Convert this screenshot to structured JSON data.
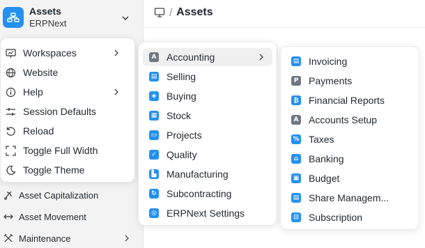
{
  "app": {
    "title": "Assets",
    "subtitle": "ERPNext"
  },
  "breadcrumb": {
    "separator": "/",
    "title": "Assets"
  },
  "sidebar": {
    "items": [
      {
        "label": "Asset Capitalization",
        "icon": "asset-capitalization-icon"
      },
      {
        "label": "Asset Movement",
        "icon": "arrows-left-right-icon"
      },
      {
        "label": "Maintenance",
        "icon": "tools-icon"
      }
    ]
  },
  "app_menu": {
    "items": [
      {
        "label": "Workspaces",
        "icon": "presentation-icon",
        "has_submenu": true
      },
      {
        "label": "Website",
        "icon": "globe-icon"
      },
      {
        "label": "Help",
        "icon": "info-icon",
        "has_submenu": true
      },
      {
        "label": "Session Defaults",
        "icon": "sliders-icon"
      },
      {
        "label": "Reload",
        "icon": "reload-icon"
      },
      {
        "label": "Toggle Full Width",
        "icon": "expand-icon"
      },
      {
        "label": "Toggle Theme",
        "icon": "moon-icon"
      }
    ]
  },
  "workspaces_menu": {
    "items": [
      {
        "label": "Accounting",
        "icon_letter": "A",
        "tone": "gray",
        "has_submenu": true,
        "active": true
      },
      {
        "label": "Selling",
        "icon_letter": "▤",
        "tone": "blue"
      },
      {
        "label": "Buying",
        "icon_letter": "◈",
        "tone": "blue"
      },
      {
        "label": "Stock",
        "icon_letter": "▦",
        "tone": "blue"
      },
      {
        "label": "Projects",
        "icon_letter": "▭",
        "tone": "blue"
      },
      {
        "label": "Quality",
        "icon_letter": "✓",
        "tone": "blue"
      },
      {
        "label": "Manufacturing",
        "icon_letter": "▙",
        "tone": "blue"
      },
      {
        "label": "Subcontracting",
        "icon_letter": "↻",
        "tone": "blue"
      },
      {
        "label": "ERPNext Settings",
        "icon_letter": "◎",
        "tone": "blue"
      }
    ]
  },
  "accounting_menu": {
    "items": [
      {
        "label": "Invoicing",
        "icon_letter": "▤",
        "tone": "blue"
      },
      {
        "label": "Payments",
        "icon_letter": "P",
        "tone": "gray"
      },
      {
        "label": "Financial Reports",
        "icon_letter": "₿",
        "tone": "blue"
      },
      {
        "label": "Accounts Setup",
        "icon_letter": "A",
        "tone": "gray"
      },
      {
        "label": "Taxes",
        "icon_letter": "%",
        "tone": "blue"
      },
      {
        "label": "Banking",
        "icon_letter": "⌂",
        "tone": "blue"
      },
      {
        "label": "Budget",
        "icon_letter": "▣",
        "tone": "blue"
      },
      {
        "label": "Share Managem...",
        "icon_letter": "▤",
        "tone": "blue"
      },
      {
        "label": "Subscription",
        "icon_letter": "⊡",
        "tone": "blue"
      }
    ]
  },
  "colors": {
    "accent": "#2490ef",
    "gray_icon": "#6f7782",
    "sidebar_bg": "#f3f3f3"
  }
}
